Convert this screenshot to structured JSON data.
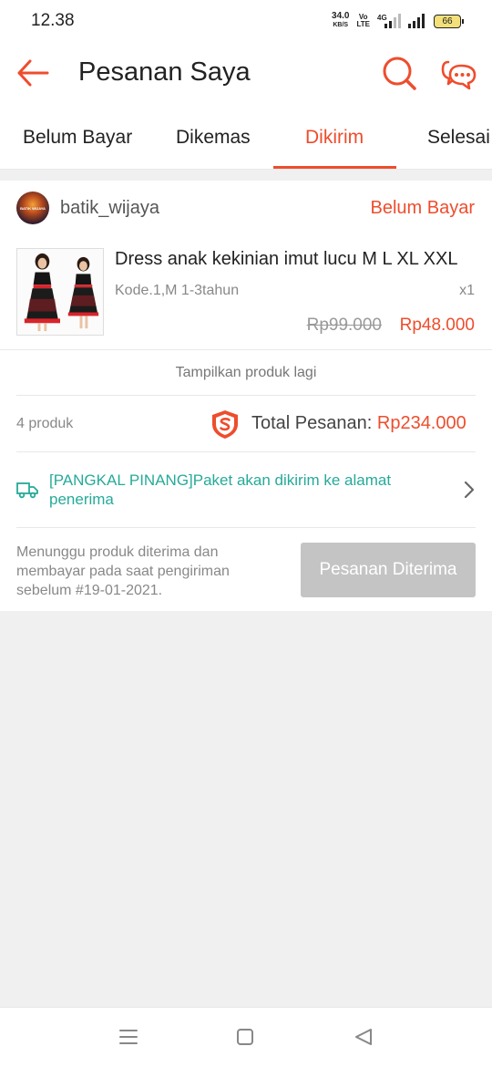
{
  "status_bar": {
    "time": "12.38",
    "net_speed": "34.0",
    "net_unit": "KB/S",
    "volte_top": "Vo",
    "volte_bottom": "LTE",
    "network": "4G",
    "battery": "66"
  },
  "header": {
    "title": "Pesanan Saya"
  },
  "tabs": [
    {
      "label": "Belum Bayar"
    },
    {
      "label": "Dikemas"
    },
    {
      "label": "Dikirim",
      "active": true
    },
    {
      "label": "Selesai"
    }
  ],
  "order": {
    "shop_name": "batik_wijaya",
    "avatar_text": "BATIK WIJAYA",
    "status": "Belum Bayar",
    "product": {
      "name": "Dress anak kekinian imut lucu M L XL XXL",
      "variant": "Kode.1,M 1-3tahun",
      "quantity": "x1",
      "price_original": "Rp99.000",
      "price_final": "Rp48.000"
    },
    "show_more": "Tampilkan produk lagi",
    "product_count": "4 produk",
    "total_label": "Total Pesanan: ",
    "total_amount": "Rp234.000",
    "shipping_text": "[PANGKAL PINANG]Paket akan dikirim ke alamat penerima",
    "wait_text": "Menunggu produk diterima dan membayar pada saat pengiriman sebelum #19-01-2021.",
    "button_label": "Pesanan Diterima"
  },
  "colors": {
    "accent": "#ee4d2d",
    "teal": "#26aa99",
    "button_disabled": "#c4c4c4",
    "background": "#f0f0f0"
  }
}
